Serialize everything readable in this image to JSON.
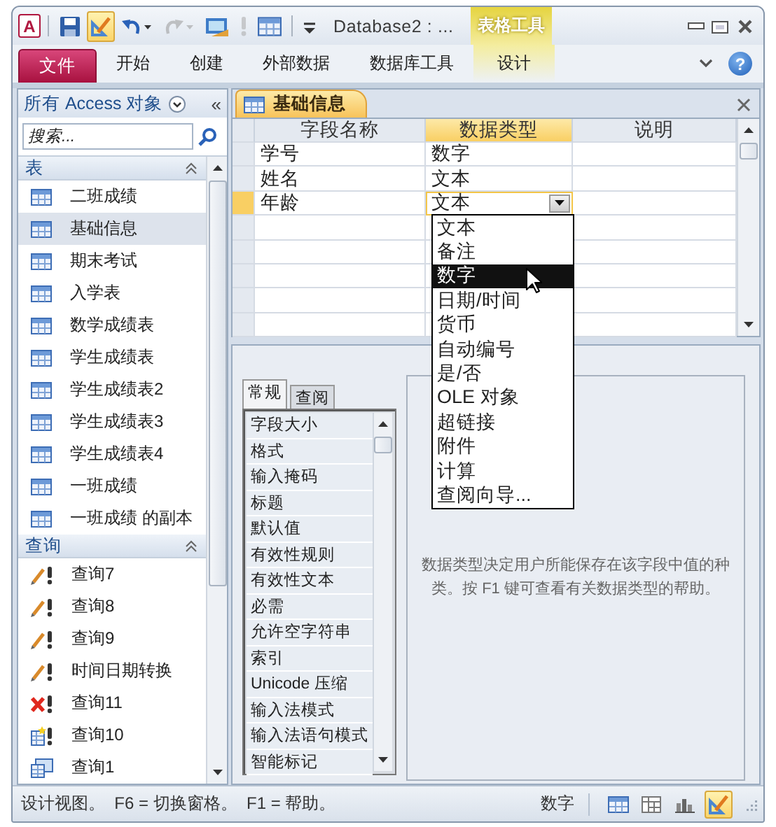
{
  "title_bar": {
    "logo": "A",
    "quick_access": [
      {
        "kind": "save",
        "selected": false,
        "disabled": false
      },
      {
        "kind": "design",
        "selected": true,
        "disabled": false
      },
      {
        "kind": "undo",
        "selected": false,
        "disabled": false
      },
      {
        "kind": "redo",
        "selected": false,
        "disabled": true
      },
      {
        "kind": "view_switch",
        "selected": false,
        "disabled": false
      },
      {
        "kind": "run",
        "selected": false,
        "disabled": true
      },
      {
        "kind": "datasheet",
        "selected": false,
        "disabled": false
      },
      {
        "kind": "customize",
        "selected": false,
        "disabled": false
      }
    ],
    "title": "Database2 : ...",
    "contextual_group": "表格工具"
  },
  "ribbon": {
    "file_tab": "文件",
    "tabs": [
      {
        "label": "开始",
        "contextual": false
      },
      {
        "label": "创建",
        "contextual": false
      },
      {
        "label": "外部数据",
        "contextual": false
      },
      {
        "label": "数据库工具",
        "contextual": false
      },
      {
        "label": "设计",
        "contextual": true
      }
    ],
    "help": "?"
  },
  "navigation": {
    "title": "所有 Access 对象",
    "collapse": "«",
    "search": {
      "placeholder": "搜索..."
    },
    "groups": [
      {
        "label": "表",
        "expanded": true,
        "items": [
          {
            "label": "二班成绩",
            "kind": "table",
            "selected": false
          },
          {
            "label": "基础信息",
            "kind": "table",
            "selected": true
          },
          {
            "label": "期末考试",
            "kind": "table",
            "selected": false
          },
          {
            "label": "入学表",
            "kind": "table",
            "selected": false
          },
          {
            "label": "数学成绩表",
            "kind": "table",
            "selected": false
          },
          {
            "label": "学生成绩表",
            "kind": "table",
            "selected": false
          },
          {
            "label": "学生成绩表2",
            "kind": "table",
            "selected": false
          },
          {
            "label": "学生成绩表3",
            "kind": "table",
            "selected": false
          },
          {
            "label": "学生成绩表4",
            "kind": "table",
            "selected": false
          },
          {
            "label": "一班成绩",
            "kind": "table",
            "selected": false
          },
          {
            "label": "一班成绩 的副本",
            "kind": "table",
            "selected": false
          }
        ]
      },
      {
        "label": "查询",
        "expanded": true,
        "items": [
          {
            "label": "查询7",
            "kind": "select",
            "selected": false
          },
          {
            "label": "查询8",
            "kind": "select",
            "selected": false
          },
          {
            "label": "查询9",
            "kind": "select",
            "selected": false
          },
          {
            "label": "时间日期转换",
            "kind": "select",
            "selected": false
          },
          {
            "label": "查询11",
            "kind": "delete",
            "selected": false
          },
          {
            "label": "查询10",
            "kind": "make_table",
            "selected": false
          },
          {
            "label": "查询1",
            "kind": "crosstab",
            "selected": false
          }
        ]
      }
    ]
  },
  "document": {
    "tab": "基础信息",
    "columns": [
      {
        "label": "字段名称",
        "selected": false
      },
      {
        "label": "数据类型",
        "selected": true
      },
      {
        "label": "说明",
        "selected": false
      }
    ],
    "rows": [
      {
        "field_name": "学号",
        "data_type": "数字",
        "current": false
      },
      {
        "field_name": "姓名",
        "data_type": "文本",
        "current": false
      },
      {
        "field_name": "年龄",
        "data_type": "文本",
        "current": true
      }
    ],
    "type_dropdown": {
      "options": [
        {
          "label": "文本",
          "selected": false
        },
        {
          "label": "备注",
          "selected": false
        },
        {
          "label": "数字",
          "selected": true
        },
        {
          "label": "日期/时间",
          "selected": false
        },
        {
          "label": "货币",
          "selected": false
        },
        {
          "label": "自动编号",
          "selected": false
        },
        {
          "label": "是/否",
          "selected": false
        },
        {
          "label": "OLE 对象",
          "selected": false
        },
        {
          "label": "超链接",
          "selected": false
        },
        {
          "label": "附件",
          "selected": false
        },
        {
          "label": "计算",
          "selected": false
        },
        {
          "label": "查阅向导...",
          "selected": false
        }
      ]
    }
  },
  "field_properties": {
    "tabs": [
      {
        "label": "常规",
        "selected": true
      },
      {
        "label": "查阅",
        "selected": false
      }
    ],
    "properties": [
      "字段大小",
      "格式",
      "输入掩码",
      "标题",
      "默认值",
      "有效性规则",
      "有效性文本",
      "必需",
      "允许空字符串",
      "索引",
      "Unicode 压缩",
      "输入法模式",
      "输入法语句模式",
      "智能标记"
    ],
    "help": "数据类型决定用户所能保存在该字段中值的种类。按 F1 键可查看有关数据类型的帮助。"
  },
  "status_bar": {
    "text": "设计视图。  F6 = 切换窗格。  F1 = 帮助。",
    "mode": "数字",
    "views": [
      {
        "kind": "datasheet",
        "selected": false
      },
      {
        "kind": "pivot_table",
        "selected": false
      },
      {
        "kind": "pivot_chart",
        "selected": false
      },
      {
        "kind": "design",
        "selected": true
      }
    ]
  }
}
